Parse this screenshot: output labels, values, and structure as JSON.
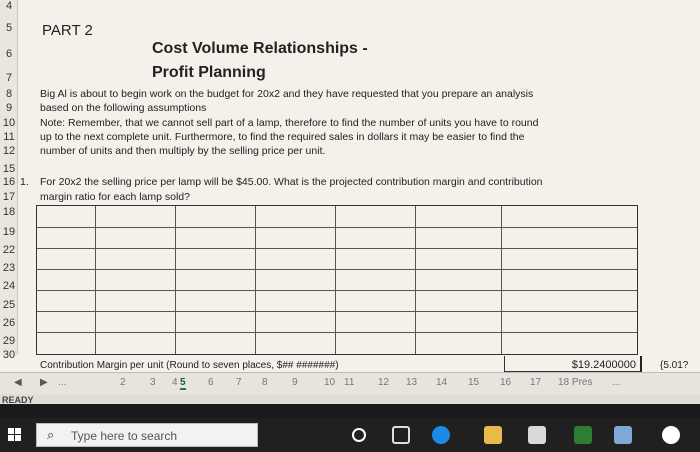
{
  "sheet": {
    "row_numbers": [
      "4",
      "5",
      "6",
      "7",
      "8",
      "9",
      "10",
      "11",
      "12",
      "15",
      "16",
      "17",
      "18",
      "19",
      "22",
      "23",
      "24",
      "25",
      "26",
      "29",
      "30"
    ],
    "part_label": "PART 2",
    "title_line1": "Cost Volume Relationships -",
    "title_line2": "Profit Planning",
    "para1": "Big Al is about to begin work on the budget for 20x2 and they have requested that you prepare an analysis",
    "para2": "based on the following assumptions",
    "para3": "Note:  Remember, that we cannot sell part of a lamp, therefore to find the number of units you have to round",
    "para4": "up to the next complete unit.  Furthermore, to find the required sales in dollars it may be easier to find the",
    "para5": "number of units and then multiply by the selling price per unit.",
    "q_num": "1.",
    "q_line1": "For 20x2 the selling price per lamp will be $45.00.  What is the projected contribution margin and contribution",
    "q_line2": "margin ratio for each lamp sold?",
    "cm_label": "Contribution Margin per unit (Round to seven places, $## #######)",
    "cm_value": "$19.2400000",
    "cm_right": "{5.01?"
  },
  "tabs": {
    "items": [
      "...",
      "2",
      "3",
      "4",
      "5",
      "6",
      "7",
      "8",
      "9",
      "10",
      "11",
      "12",
      "13",
      "14",
      "15",
      "16",
      "17",
      "18 Pres",
      "..."
    ],
    "active": "5"
  },
  "status": {
    "ready": "READY"
  },
  "taskbar": {
    "search_placeholder": "Type here to search"
  }
}
